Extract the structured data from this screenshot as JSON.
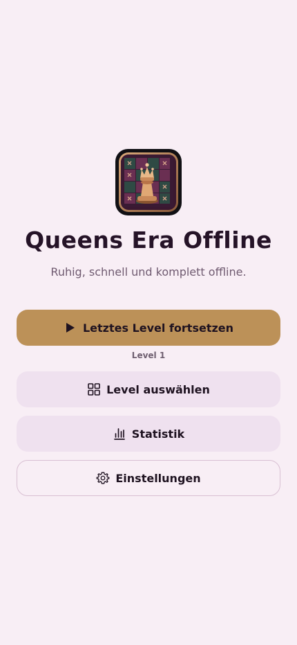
{
  "app": {
    "title": "Queens Era Offline",
    "subtitle": "Ruhig, schnell und komplett offline.",
    "logo_icon": "chess-queen-icon"
  },
  "actions": {
    "continue_label": "Letztes Level fortsetzen",
    "continue_icon": "play-icon",
    "current_level": "Level 1",
    "select_level_label": "Level auswählen",
    "select_level_icon": "grid-icon",
    "stats_label": "Statistik",
    "stats_icon": "bar-chart-icon",
    "settings_label": "Einstellungen",
    "settings_icon": "gear-icon"
  },
  "colors": {
    "background": "#f8eef5",
    "primary_button": "#bc9158",
    "tonal_button": "#efe1ef",
    "title_text": "#251327"
  }
}
